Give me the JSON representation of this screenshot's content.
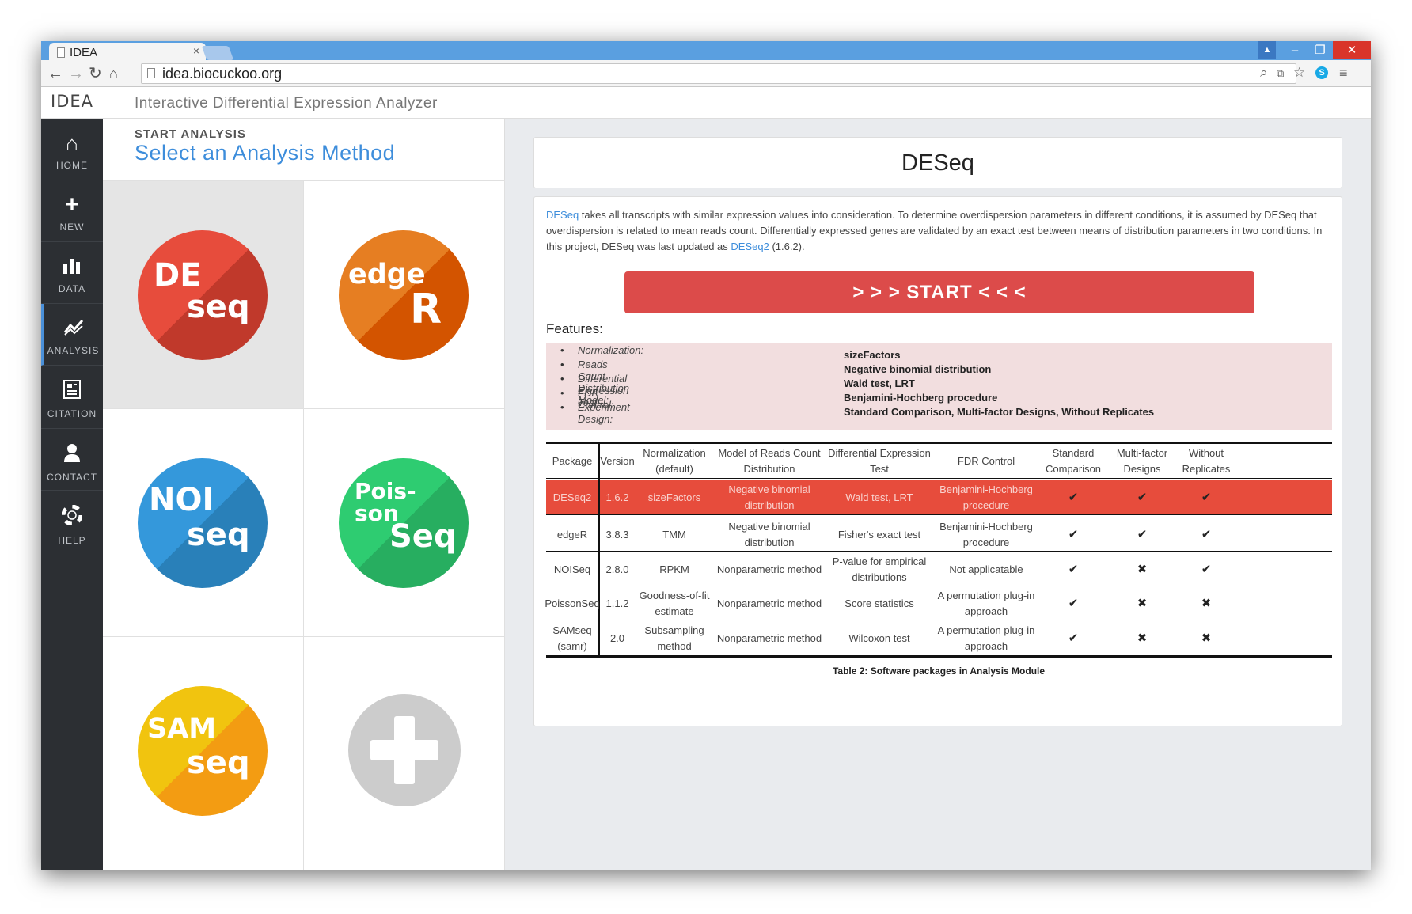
{
  "browser": {
    "tab_title": "IDEA",
    "tab_close": "×",
    "url": "idea.biocuckoo.org",
    "win_min": "–",
    "win_max": "❐",
    "win_close": "✕"
  },
  "app": {
    "logo": "IDEA",
    "title": "Interactive Differential Expression Analyzer"
  },
  "sidebar": {
    "items": [
      {
        "label": "HOME",
        "icon": "home-icon"
      },
      {
        "label": "NEW",
        "icon": "plus-icon"
      },
      {
        "label": "DATA",
        "icon": "bar-chart-icon"
      },
      {
        "label": "ANALYSIS",
        "icon": "line-chart-icon"
      },
      {
        "label": "CITATION",
        "icon": "document-icon"
      },
      {
        "label": "CONTACT",
        "icon": "user-icon"
      },
      {
        "label": "HELP",
        "icon": "lifebuoy-icon"
      }
    ],
    "active": "ANALYSIS"
  },
  "left": {
    "kicker": "START ANALYSIS",
    "heading": "Select an Analysis Method",
    "methods": [
      {
        "line1": "DE",
        "line2": "seq",
        "color1": "#e74c3c",
        "color2": "#c0392b"
      },
      {
        "line1": "edge",
        "line2": "R",
        "color1": "#e67e22",
        "color2": "#d35400"
      },
      {
        "line1": "NOI",
        "line2": "seq",
        "color1": "#3498db",
        "color2": "#2980b9"
      },
      {
        "line1": "Pois-\nson",
        "line2": "Seq",
        "color1": "#2ecc71",
        "color2": "#27ae60"
      },
      {
        "line1": "SAM",
        "line2": "seq",
        "color1": "#f1c40f",
        "color2": "#f39c12"
      },
      {
        "line1": "",
        "line2": "",
        "color1": "#cccccc",
        "color2": "#cccccc"
      }
    ]
  },
  "main": {
    "title": "DESeq",
    "desc_link1": "DESeq",
    "desc_text1": " takes all transcripts with similar expression values into consideration. To determine overdispersion parameters in different conditions, it is assumed by DESeq that overdispersion is related to mean reads count. Differentially expressed genes are validated by an exact test between means of distribution parameters in two conditions. In this project, DESeq was last updated as ",
    "desc_link2": "DESeq2",
    "desc_text2": " (1.6.2).",
    "start_label": "> > > START < < <",
    "features_heading": "Features:",
    "features": [
      {
        "label": "Normalization:",
        "value": "sizeFactors"
      },
      {
        "label": "Reads Count Distribution Model:",
        "value": "Negative binomial distribution"
      },
      {
        "label": "Differential Expression Test:",
        "value": "Wald test, LRT"
      },
      {
        "label": "FDR Control:",
        "value": "Benjamini-Hochberg procedure"
      },
      {
        "label": "Experiment Design:",
        "value": "Standard Comparison, Multi-factor Designs, Without Replicates"
      }
    ],
    "table": {
      "headers": [
        "Package",
        "Version",
        "Normalization (default)",
        "Model of Reads Count Distribution",
        "Differential Expression Test",
        "FDR Control",
        "Standard Comparison",
        "Multi-factor Designs",
        "Without Replicates"
      ],
      "rows": [
        [
          "DESeq2",
          "1.6.2",
          "sizeFactors",
          "Negative binomial distribution",
          "Wald test, LRT",
          "Benjamini-Hochberg procedure",
          "✔",
          "✔",
          "✔"
        ],
        [
          "edgeR",
          "3.8.3",
          "TMM",
          "Negative binomial distribution",
          "Fisher's exact test",
          "Benjamini-Hochberg procedure",
          "✔",
          "✔",
          "✔"
        ],
        [
          "NOISeq",
          "2.8.0",
          "RPKM",
          "Nonparametric method",
          "P-value for empirical distributions",
          "Not applicatable",
          "✔",
          "✖",
          "✔"
        ],
        [
          "PoissonSeq",
          "1.1.2",
          "Goodness-of-fit estimate",
          "Nonparametric method",
          "Score statistics",
          "A permutation plug-in approach",
          "✔",
          "✖",
          "✖"
        ],
        [
          "SAMseq (samr)",
          "2.0",
          "Subsampling method",
          "Nonparametric method",
          "Wilcoxon test",
          "A permutation plug-in approach",
          "✔",
          "✖",
          "✖"
        ]
      ],
      "highlight_color": "#e74c3c",
      "caption": "Table 2: Software packages in Analysis Module"
    }
  }
}
